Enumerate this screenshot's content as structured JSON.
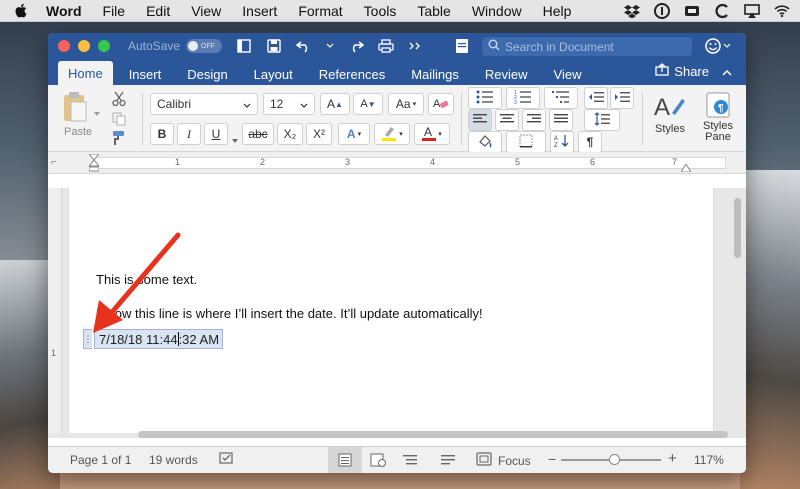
{
  "menubar": {
    "app_name": "Word",
    "items": [
      "File",
      "Edit",
      "View",
      "Insert",
      "Format",
      "Tools",
      "Table",
      "Window",
      "Help"
    ],
    "tray_icons": [
      "dropbox-icon",
      "onepassword-icon",
      "cloud-icon",
      "c-icon",
      "airplay-icon",
      "wifi-icon"
    ]
  },
  "titlebar": {
    "autosave_label": "AutoSave",
    "autosave_state": "OFF",
    "search_placeholder": "Search in Document"
  },
  "tabs": [
    "Home",
    "Insert",
    "Design",
    "Layout",
    "References",
    "Mailings",
    "Review",
    "View"
  ],
  "active_tab": "Home",
  "share_label": "Share",
  "ribbon": {
    "paste_label": "Paste",
    "font_name": "Calibri",
    "font_size": "12",
    "bold": "B",
    "italic": "I",
    "underline": "U",
    "strike": "abc",
    "subscript": "X₂",
    "superscript": "X²",
    "styles_label": "Styles",
    "styles_pane_label1": "Styles",
    "styles_pane_label2": "Pane"
  },
  "ruler_numbers": [
    "1",
    "2",
    "3",
    "4",
    "5",
    "6",
    "7"
  ],
  "vruler_number": "1",
  "document": {
    "line1": "This is some text.",
    "line2": "Below this line is where I’ll insert the date. It’ll update automatically!",
    "date_before_caret": "7/18/18 11:44",
    "date_after_caret": ":32 AM"
  },
  "statusbar": {
    "page": "Page 1 of 1",
    "words": "19 words",
    "focus_label": "Focus",
    "zoom_minus": "−",
    "zoom_plus": "+",
    "zoom": "117%"
  },
  "colors": {
    "word_blue": "#2b579a",
    "arrow_red": "#e8321e",
    "field_highlight": "#d9e3f1"
  }
}
